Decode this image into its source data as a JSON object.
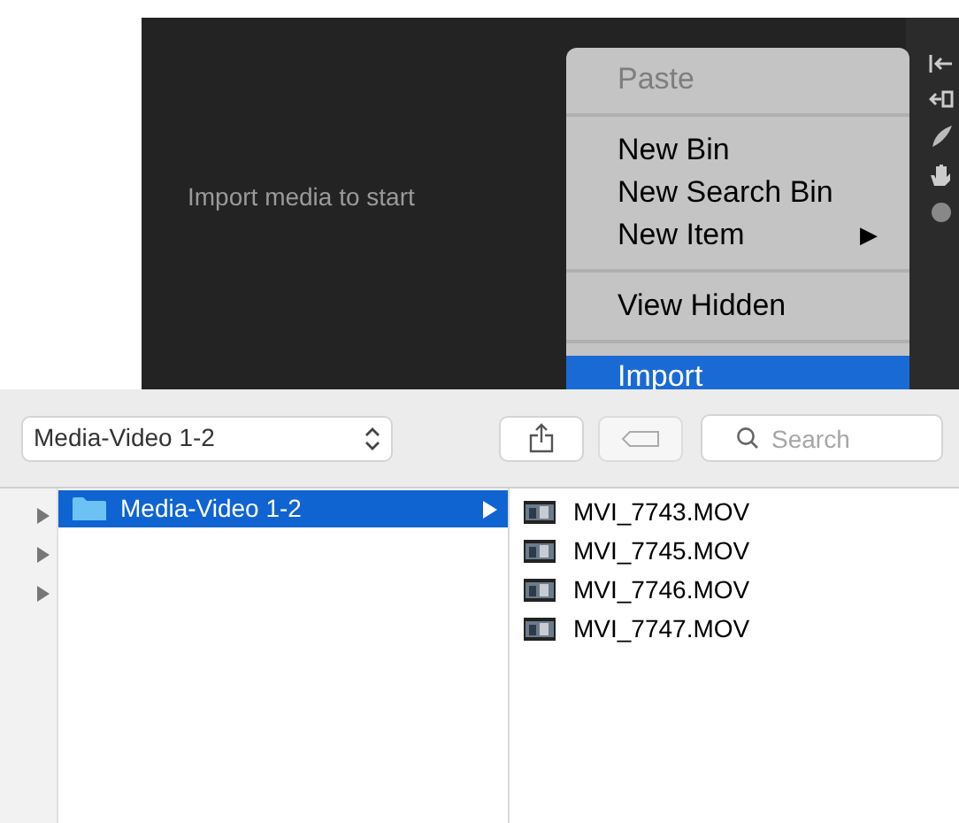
{
  "project_panel": {
    "empty_message": "Import media to start"
  },
  "context_menu": {
    "items": [
      {
        "kind": "item",
        "label": "Paste",
        "disabled": true,
        "selected": false
      },
      {
        "kind": "separator"
      },
      {
        "kind": "item",
        "label": "New Bin",
        "disabled": false,
        "selected": false
      },
      {
        "kind": "item",
        "label": "New Search Bin",
        "disabled": false,
        "selected": false
      },
      {
        "kind": "submenu",
        "label": "New Item",
        "disabled": false,
        "selected": false,
        "arrow": "▶"
      },
      {
        "kind": "separator"
      },
      {
        "kind": "item",
        "label": "View Hidden",
        "disabled": false,
        "selected": false
      },
      {
        "kind": "separator"
      },
      {
        "kind": "item",
        "label": "Import",
        "disabled": false,
        "selected": true
      }
    ]
  },
  "file_dialog": {
    "location": "Media-Video 1-2",
    "search": {
      "placeholder": "Search"
    },
    "sidebar_rows": [
      {
        "expanded": false
      },
      {
        "expanded": false
      },
      {
        "expanded": false
      }
    ],
    "folders": [
      {
        "name": "Media-Video 1-2",
        "selected": true
      }
    ],
    "files": [
      {
        "name": "MVI_7743.MOV"
      },
      {
        "name": "MVI_7745.MOV"
      },
      {
        "name": "MVI_7746.MOV"
      },
      {
        "name": "MVI_7747.MOV"
      }
    ]
  }
}
